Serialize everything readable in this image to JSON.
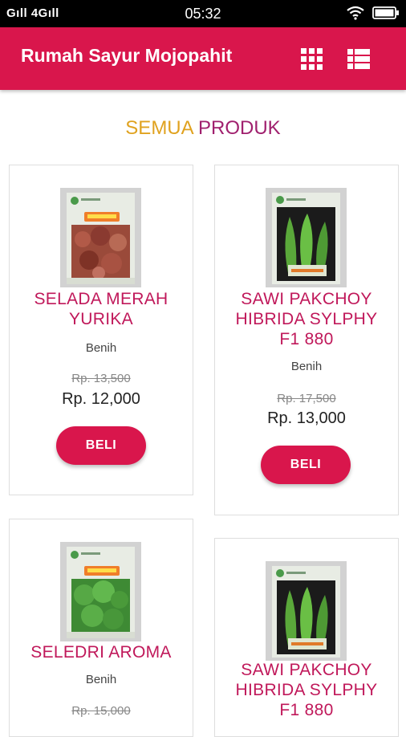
{
  "status_bar": {
    "signal_text": "Gıll 4Gıll",
    "time": "05:32",
    "icons": [
      "wifi-icon",
      "battery-icon"
    ]
  },
  "app_bar": {
    "title": "Rumah Sayur Mojopahit",
    "actions": [
      "grid-view-icon",
      "list-view-icon"
    ],
    "color": "#d9164c"
  },
  "section": {
    "title_part1": "SEMUA",
    "title_part2": "PRODUK",
    "color_part1": "#e0a21f",
    "color_part2": "#a0206e"
  },
  "products": [
    {
      "name_line1": "SELADA MERAH",
      "name_line2": "YURIKA",
      "category": "Benih",
      "old_price": "Rp. 13,500",
      "price": "Rp. 12,000",
      "button": "BELI",
      "image": "red-lettuce-seed-packet"
    },
    {
      "name_line1": "SAWI PAKCHOY",
      "name_line2": "HIBRIDA SYLPHY",
      "name_line3": "F1 880",
      "category": "Benih",
      "old_price": "Rp. 17,500",
      "price": "Rp. 13,000",
      "button": "BELI",
      "image": "pakchoy-seed-packet"
    },
    {
      "name_line1": "SELEDRI AROMA",
      "category": "Benih",
      "old_price": "Rp. 15,000",
      "image": "celery-seed-packet"
    },
    {
      "name_line1": "SAWI PAKCHOY",
      "name_line2": "HIBRIDA SYLPHY",
      "name_line3": "F1 880",
      "image": "pakchoy-seed-packet"
    }
  ]
}
